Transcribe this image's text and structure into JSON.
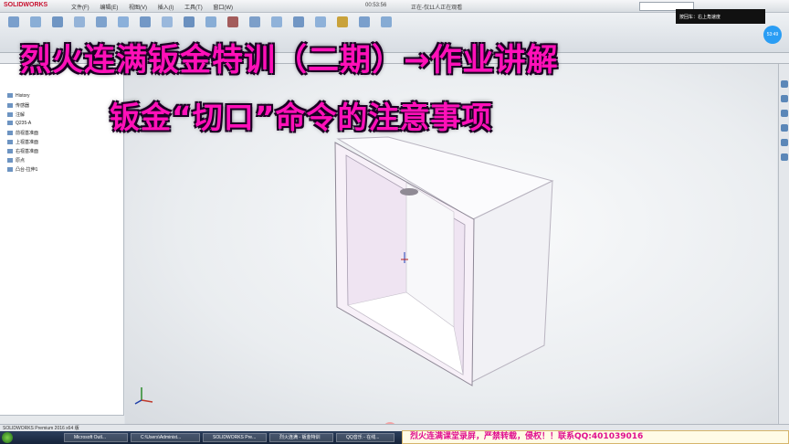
{
  "app": {
    "logo": "SOLIDWORKS",
    "menus": [
      "文件(F)",
      "编辑(E)",
      "视图(V)",
      "插入(I)",
      "工具(T)",
      "窗口(W)"
    ],
    "timer": "00:53:56",
    "net": "正在-仅11人正在观看"
  },
  "overlay": {
    "title_line1": "烈火连满钣金特训（二期）→作业讲解",
    "title_line2": "钣金“切口”命令的注意事项"
  },
  "notify": {
    "text": "按回车：右上角速度",
    "badge": "53:49"
  },
  "tree": {
    "items": [
      "History",
      "传感器",
      "注解",
      "Q235-A",
      "前视基准面",
      "上视基准面",
      "右视基准面",
      "原点",
      "凸台-拉伸1"
    ]
  },
  "statusbar": {
    "text": "SOLIDWORKS Premium 2016 x64 版"
  },
  "taskbar": {
    "tasks": [
      "Microsoft Outl...",
      "C:\\Users\\Administ...",
      "SOLIDWORKS Pre...",
      "烈火连满 - 钣金特训",
      "QQ音乐 - 在线..."
    ]
  },
  "banner": {
    "text": "烈火连满课堂录屏，严禁转载，侵权！！联系QQ:401039016"
  },
  "colors": {
    "overlay_text": "#ff10b8",
    "part_face": "#ffffff",
    "part_inner": "#efe4f2"
  }
}
